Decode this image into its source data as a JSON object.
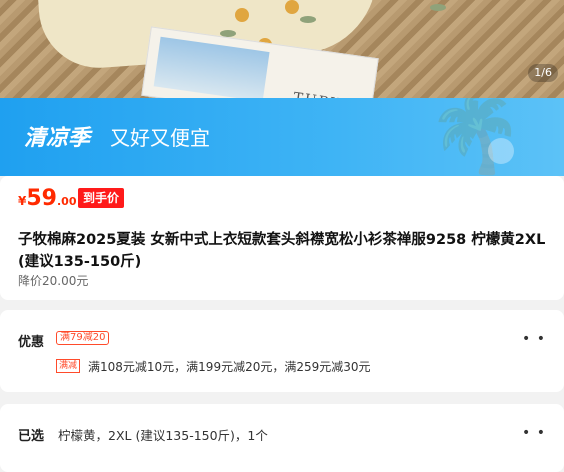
{
  "hero": {
    "pager": "1/6",
    "book_text": "TURY"
  },
  "banner": {
    "title": "清凉季",
    "subtitle": "又好又便宜"
  },
  "price": {
    "currency": "¥",
    "integer": "59",
    "decimal": ".00",
    "badge": "到手价"
  },
  "product": {
    "title": "子牧棉麻2025夏装 女新中式上衣短款套头斜襟宽松小衫茶禅服9258 柠檬黄2XL (建议135-150斤)",
    "drop_note": "降价20.00元"
  },
  "promo": {
    "label": "优惠",
    "coupon": "满79减20",
    "full_tag": "满减",
    "text": "满108元减10元，满199元减20元，满259元减30元",
    "more": "• •"
  },
  "selected": {
    "label": "已选",
    "text": "柠檬黄，2XL (建议135-150斤)，1个",
    "more": "• •"
  },
  "colors": {
    "accent": "#ff2a00",
    "banner": "#1fa0f0"
  }
}
